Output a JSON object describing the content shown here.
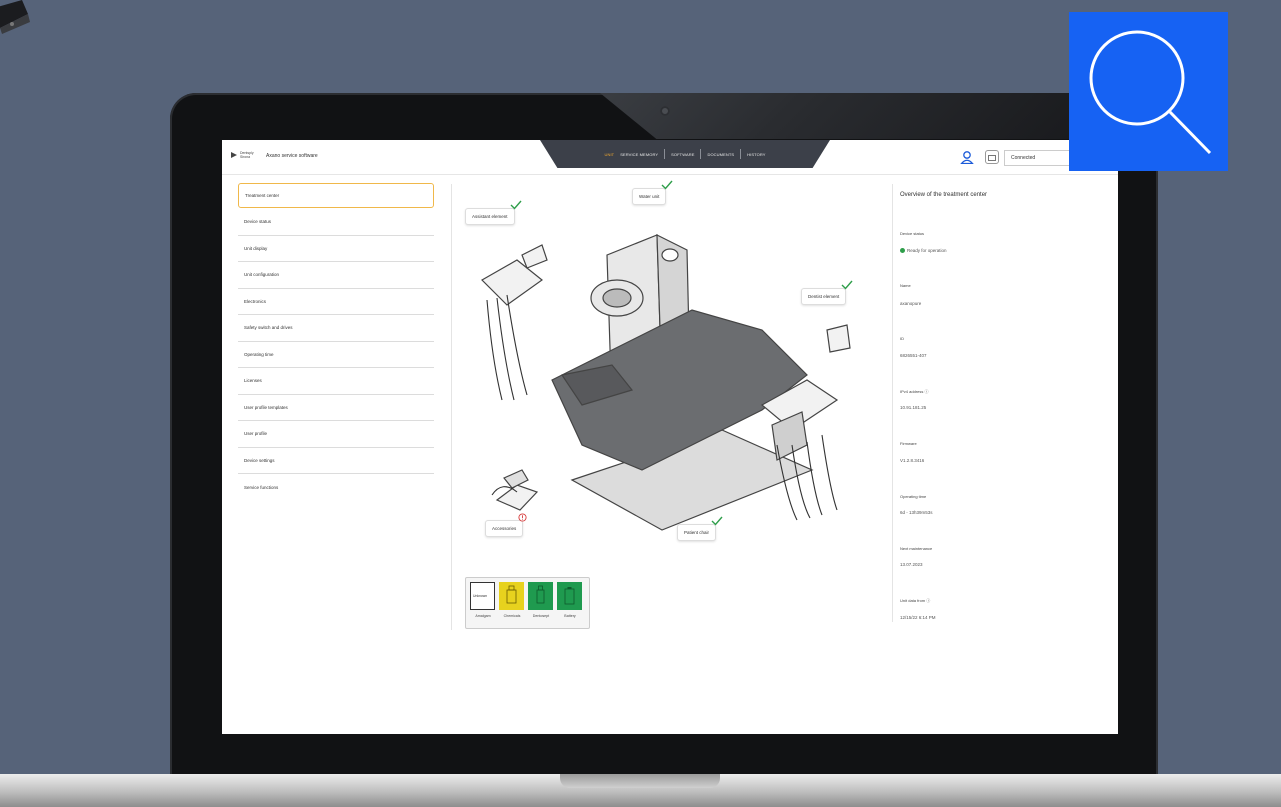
{
  "colors": {
    "background": "#566379",
    "accent": "#f0a830",
    "ok": "#2e9e4a",
    "warning": "#e7d21e",
    "overlay": "#1662f3",
    "consumable_ok": "#1f9a4f"
  },
  "header": {
    "logo_text": "Dentsply Sirona",
    "app_title": "Axano service software",
    "nav": [
      {
        "label": "UNIT",
        "active": true
      },
      {
        "label": "SERVICE MEMORY",
        "active": false
      },
      {
        "label": "SOFTWARE",
        "active": false
      },
      {
        "label": "DOCUMENTS",
        "active": false
      },
      {
        "label": "HISTORY",
        "active": false
      }
    ],
    "user_icon": "user-icon",
    "device_icon": "device-icon",
    "connection_status": "Connected"
  },
  "sidebar": {
    "items": [
      {
        "label": "Treatment center",
        "active": true
      },
      {
        "label": "Device status"
      },
      {
        "label": "Unit display"
      },
      {
        "label": "Unit configuration"
      },
      {
        "label": "Electronics"
      },
      {
        "label": "Safety switch and drives"
      },
      {
        "label": "Operating time"
      },
      {
        "label": "Licenses"
      },
      {
        "label": "User profile templates"
      },
      {
        "label": "User profile"
      },
      {
        "label": "Device settings"
      },
      {
        "label": "Service functions"
      }
    ]
  },
  "illustration": {
    "labels": {
      "water_unit": "Water unit",
      "assistant_element": "Assistant element",
      "dentist_element": "Dentist element",
      "accessories": "Accessories",
      "patient_chair": "Patient chair"
    }
  },
  "consumables": [
    {
      "label": "Amalgam",
      "status_text": "Unknown",
      "color": "#ffffff"
    },
    {
      "label": "Chemicals",
      "status_text": "",
      "color": "#e7d21e"
    },
    {
      "label": "Dentosept",
      "status_text": "",
      "color": "#1f9a4f"
    },
    {
      "label": "Battery",
      "status_text": "",
      "color": "#1f9a4f"
    }
  ],
  "overview": {
    "title": "Overview of the treatment center",
    "device_status_label": "Device status",
    "device_status_value": "Ready for operation",
    "name_label": "Name",
    "name_value": "axanopure",
    "id_label": "ID",
    "id_value": "6826551-407",
    "ipv4_label": "IPv4 address ⓘ",
    "ipv4_value": "10.91.181.25",
    "firmware_label": "Firmware",
    "firmware_value": "V1.2.8.3416",
    "operating_time_label": "Operating time",
    "operating_time_value": "6d - 13h39m53s",
    "next_maintenance_label": "Next maintenance",
    "next_maintenance_value": "13.07.2023",
    "unit_data_label": "Unit data from ⓘ",
    "unit_data_value": "12/15/22 6:14 PM"
  },
  "overlay_icon": "search-icon"
}
